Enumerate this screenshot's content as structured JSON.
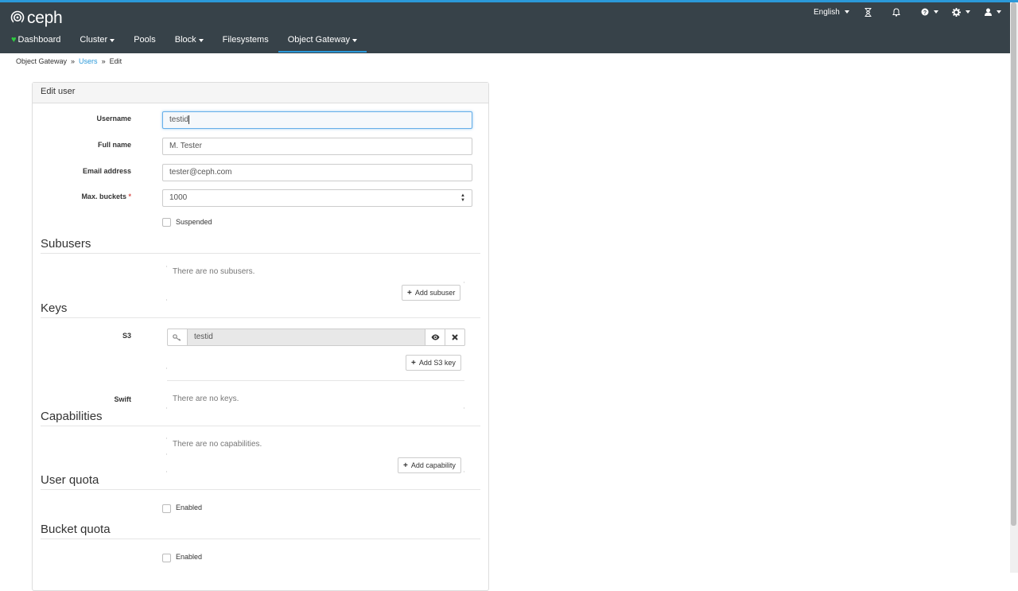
{
  "brand": "ceph",
  "top_right": {
    "language": "English",
    "icons": [
      "hourglass-icon",
      "bell-icon",
      "help-icon",
      "gear-icon",
      "user-icon"
    ]
  },
  "nav": {
    "dashboard": "Dashboard",
    "cluster": "Cluster",
    "pools": "Pools",
    "block": "Block",
    "filesystems": "Filesystems",
    "object_gateway": "Object Gateway"
  },
  "breadcrumb": {
    "root": "Object Gateway",
    "users": "Users",
    "current": "Edit"
  },
  "form": {
    "title": "Edit user",
    "username_label": "Username",
    "username_value": "testid",
    "fullname_label": "Full name",
    "fullname_value": "M. Tester",
    "email_label": "Email address",
    "email_value": "tester@ceph.com",
    "maxbuckets_label": "Max. buckets",
    "maxbuckets_required": "*",
    "maxbuckets_value": "1000",
    "suspended_label": "Suspended",
    "suspended_checked": false
  },
  "subusers": {
    "title": "Subusers",
    "empty": "There are no subusers.",
    "add_button": "Add subuser"
  },
  "keys": {
    "title": "Keys",
    "s3_label": "S3",
    "s3_key_value": "testid",
    "add_s3_button": "Add S3 key",
    "swift_label": "Swift",
    "swift_empty": "There are no keys."
  },
  "capabilities": {
    "title": "Capabilities",
    "empty": "There are no capabilities.",
    "add_button": "Add capability"
  },
  "user_quota": {
    "title": "User quota",
    "enabled_label": "Enabled",
    "enabled_checked": false
  },
  "bucket_quota": {
    "title": "Bucket quota",
    "enabled_label": "Enabled",
    "enabled_checked": false
  },
  "colors": {
    "navbar": "#374249",
    "accent": "#2b99d9",
    "health_ok": "#2ecc40",
    "required": "#d9534f"
  }
}
